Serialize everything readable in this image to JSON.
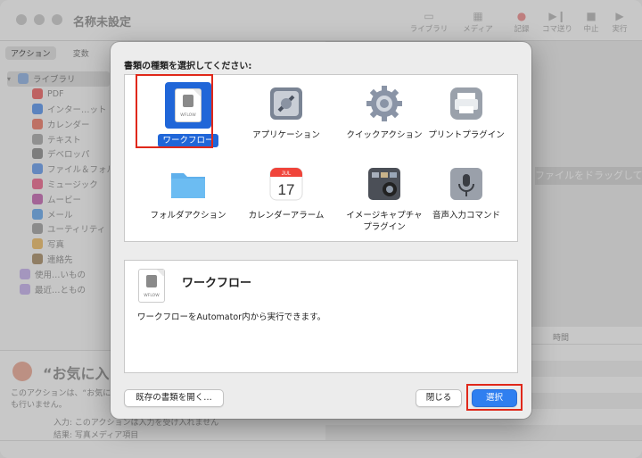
{
  "window": {
    "title": "名称未設定"
  },
  "toolbar": {
    "items": [
      {
        "label": "ライブラリ",
        "icon": "library-icon"
      },
      {
        "label": "メディア",
        "icon": "media-icon"
      },
      {
        "label": "記録",
        "icon": "record-icon"
      },
      {
        "label": "コマ送り",
        "icon": "step-icon"
      },
      {
        "label": "中止",
        "icon": "stop-icon"
      },
      {
        "label": "実行",
        "icon": "run-icon"
      }
    ]
  },
  "sidebar": {
    "tabs": [
      "アクション",
      "変数"
    ],
    "library_root": "ライブラリ",
    "items": [
      {
        "label": "PDF",
        "color": "#e87878"
      },
      {
        "label": "インター…ット",
        "color": "#6fa0e8"
      },
      {
        "label": "カレンダー",
        "color": "#e88a7a"
      },
      {
        "label": "テキスト",
        "color": "#b0b0b0"
      },
      {
        "label": "デベロッパ",
        "color": "#999999"
      },
      {
        "label": "ファイル＆フォルダ",
        "color": "#7aa6e8"
      },
      {
        "label": "ミュージック",
        "color": "#e87a9a"
      },
      {
        "label": "ムービー",
        "color": "#c77ab8"
      },
      {
        "label": "メール",
        "color": "#7ab0e8"
      },
      {
        "label": "ユーティリティ",
        "color": "#aaaaaa"
      },
      {
        "label": "写真",
        "color": "#e8c07a"
      },
      {
        "label": "連絡先",
        "color": "#b09a7a"
      }
    ],
    "folders": [
      "使用…いもの",
      "最近…ともの"
    ]
  },
  "favorites": {
    "title": "“お気に入り",
    "description": "このアクションは、“お気に入りのアクション”を含んでいません。このアクションは何も行いません。",
    "input_label": "入力:",
    "input_value": "このアクションは入力を受け入れません",
    "result_label": "結果:",
    "result_value": "写真メディア項目"
  },
  "workflow": {
    "drag_hint": "ファイルをドラッグしてく",
    "log_column": "時間"
  },
  "dialog": {
    "heading": "書類の種類を選択してください:",
    "doc_types": [
      {
        "label": "ワークフロー",
        "icon": "workflow-icon",
        "selected": true
      },
      {
        "label": "アプリケーション",
        "icon": "application-icon",
        "selected": false
      },
      {
        "label": "クイックアクション",
        "icon": "quick-action-gear-icon",
        "selected": false
      },
      {
        "label": "プリントプラグイン",
        "icon": "printer-icon",
        "selected": false
      },
      {
        "label": "フォルダアクション",
        "icon": "folder-icon",
        "selected": false
      },
      {
        "label": "カレンダーアラーム",
        "icon": "calendar-icon",
        "selected": false
      },
      {
        "label": "イメージキャプチャ\nプラグイン",
        "icon": "image-capture-icon",
        "selected": false
      },
      {
        "label": "音声入力コマンド",
        "icon": "microphone-icon",
        "selected": false
      }
    ],
    "calendar_month": "JUL",
    "calendar_day": "17",
    "doc_icon_text": "WFLOW",
    "description_title": "ワークフロー",
    "description_text": "ワークフローをAutomator内から実行できます。",
    "open_existing": "既存の書類を開く…",
    "close": "閉じる",
    "choose": "選択"
  }
}
